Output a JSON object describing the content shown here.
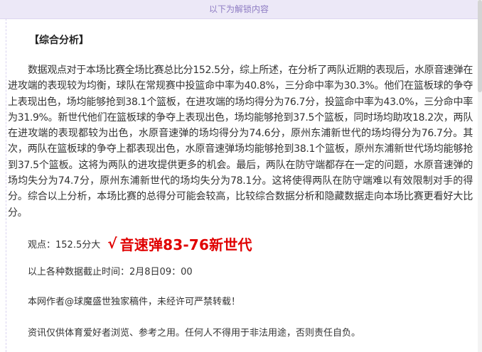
{
  "unlock_banner": "以下为解锁内容",
  "section_title": "【综合分析】",
  "analysis_text": "数据观点对于本场比赛全场比赛总比分152.5分，综上所述，在分析了两队近期的表现后，水原音速弹在进攻端的表现较为均衡，球队在常规赛中投篮命中率为40.8%，三分命中率为30.3%。他们在篮板球的争夺上表现出色，场均能够抢到38.1个篮板，在进攻端的场均得分为76.7分，投篮命中率为43.0%，三分命中率为31.9%。新世代他们在篮板球的争夺上表现出色，场均能够抢到37.5个篮板，同时场均助攻18.2次，两队在进攻端的表现都较为出色，水原音速弹的场均得分为74.6分，原州东浦新世代的场均得分为76.7分。其次，两队在篮板球的争夺上都表现出色，水原音速弹场均能够抢到38.1个篮板，原州东浦新世代场均能够抢到37.5个篮板。这将为两队的进攻提供更多的机会。最后，两队在防守端都存在一定的问题，水原音速弹的场均失分为74.7分，原州东浦新世代的场均失分为78.1分。这将使得两队在防守端难以有效限制对手的得分。综合以上分析，本场比赛的总得分可能会较高，比较综合数据分析和隐藏数据走向本场比赛更看好大比分。",
  "pick": {
    "label": "观点：152.5分大",
    "check_symbol": "√",
    "result": "音速弹83-76新世代",
    "result_color": "#e00000"
  },
  "data_cutoff": "以上各种数据截止时间：2月8日09：00",
  "author_note": "本网作者@球魔盛世独家稿件，未经许可严禁转载！",
  "disclaimer": "资讯仅供体育爱好者浏览、参考之用。任何人不得用于非法用途，否则责任自负。",
  "colors": {
    "banner_bg": "#ece8f7",
    "banner_text": "#8e7cc3",
    "accent_red": "#e00000"
  }
}
